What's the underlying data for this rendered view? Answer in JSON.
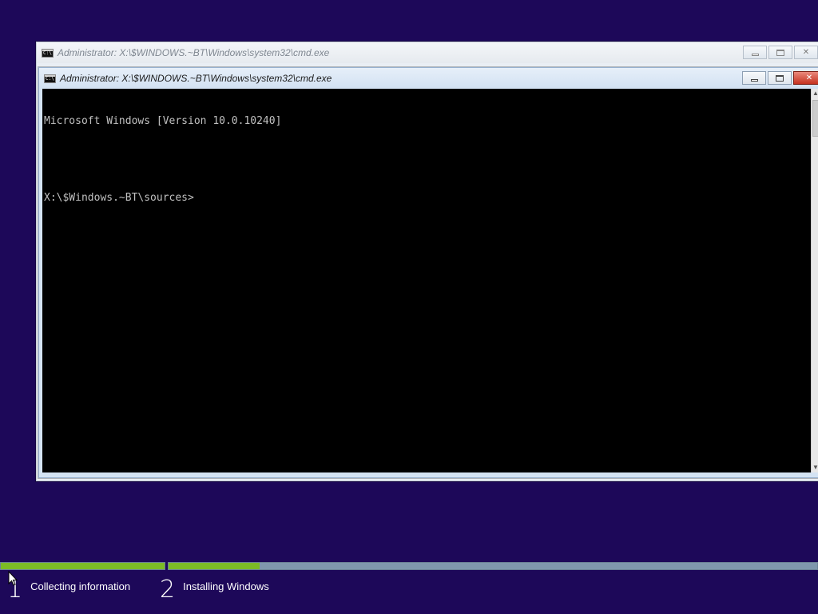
{
  "windows": [
    {
      "title": "Administrator: X:\\$WINDOWS.~BT\\Windows\\system32\\cmd.exe",
      "state": "inactive"
    },
    {
      "title": "Administrator: X:\\$WINDOWS.~BT\\Windows\\system32\\cmd.exe",
      "state": "active",
      "console_lines": [
        "Microsoft Windows [Version 10.0.10240]",
        "",
        "X:\\$Windows.~BT\\sources>"
      ]
    }
  ],
  "icons": {
    "app": "cmd-icon",
    "minimize": "minimize-icon",
    "maximize": "maximize-icon",
    "close": "close-icon",
    "close_glyph": "✕",
    "scroll_up_glyph": "▲",
    "scroll_down_glyph": "▼"
  },
  "colors": {
    "desktop_background": "#1d0859",
    "progress_fill": "#7cbb25",
    "progress_track": "#7f97ad",
    "close_button": "#c5311f"
  },
  "setup": {
    "steps": [
      {
        "number": "1",
        "label": "Collecting information",
        "progress": 1.0
      },
      {
        "number": "2",
        "label": "Installing Windows",
        "progress": 0.14
      }
    ]
  }
}
